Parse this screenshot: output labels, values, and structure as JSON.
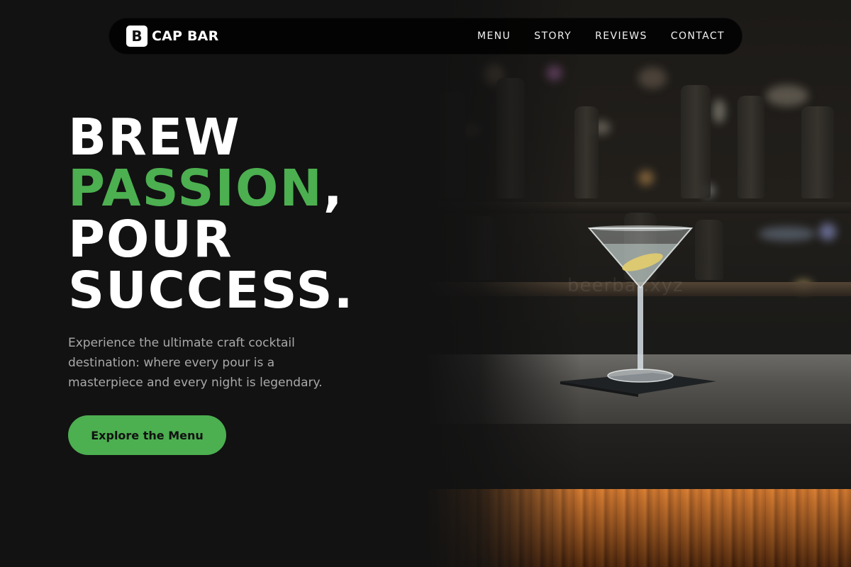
{
  "brand": {
    "mark": "B",
    "name": "CAP BAR"
  },
  "nav": {
    "items": [
      "MENU",
      "STORY",
      "REVIEWS",
      "CONTACT"
    ]
  },
  "hero": {
    "line1": "BREW",
    "line2_accent": "PASSION",
    "line2_tail": ",",
    "line3": "POUR",
    "line4": "SUCCESS.",
    "subtitle": "Experience the ultimate craft cocktail destination: where every pour is a masterpiece and every night is legendary.",
    "cta_label": "Explore the Menu"
  },
  "image": {
    "watermark": "beerbar.xyz",
    "subject": "martini-glass-on-bar-counter"
  },
  "colors": {
    "background": "#121212",
    "accent": "#4caf50",
    "text": "#ffffff",
    "muted": "#a9a9a9"
  }
}
